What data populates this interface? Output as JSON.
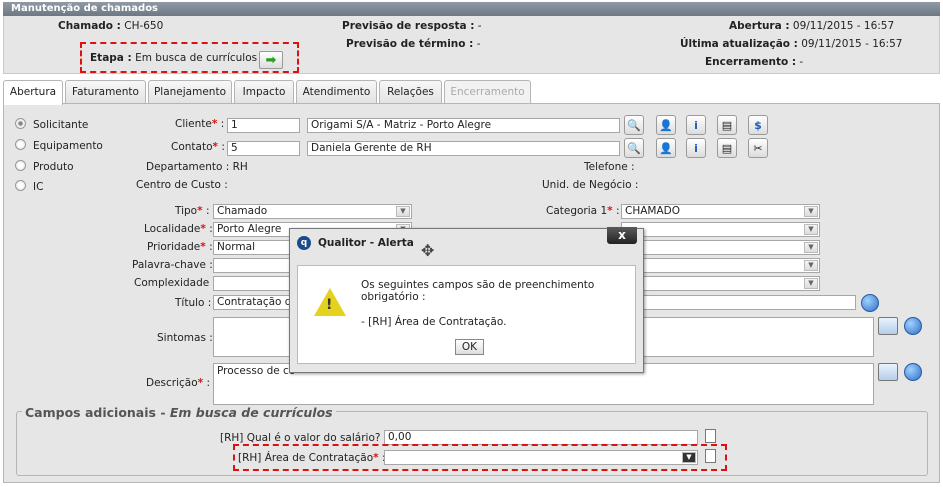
{
  "window_title": "Manutenção de chamados",
  "header": {
    "chamado_label": "Chamado :",
    "chamado_value": "CH-650",
    "previsao_resposta_label": "Previsão de resposta :",
    "previsao_resposta_value": "-",
    "previsao_termino_label": "Previsão de término :",
    "previsao_termino_value": "-",
    "abertura_label": "Abertura :",
    "abertura_value": "09/11/2015 - 16:57",
    "ultima_label": "Última atualização :",
    "ultima_value": "09/11/2015 - 16:57",
    "encerramento_label": "Encerramento :",
    "encerramento_value": "-",
    "etapa_label": "Etapa :",
    "etapa_value": "Em busca de currículos"
  },
  "tabs": [
    {
      "label": "Abertura"
    },
    {
      "label": "Faturamento"
    },
    {
      "label": "Planejamento"
    },
    {
      "label": "Impacto"
    },
    {
      "label": "Atendimento"
    },
    {
      "label": "Relações"
    },
    {
      "label": "Encerramento"
    }
  ],
  "radios": [
    {
      "label": "Solicitante",
      "selected": true
    },
    {
      "label": "Equipamento",
      "selected": false
    },
    {
      "label": "Produto",
      "selected": false
    },
    {
      "label": "IC",
      "selected": false
    }
  ],
  "form": {
    "cliente_label": "Cliente",
    "cliente_code": "1",
    "cliente_name": "Origami S/A - Matriz - Porto Alegre",
    "contato_label": "Contato",
    "contato_code": "5",
    "contato_name": "Daniela Gerente de RH",
    "departamento_label": "Departamento :",
    "departamento_value": "RH",
    "centro_label": "Centro de Custo :",
    "centro_value": "",
    "telefone_label": "Telefone :",
    "telefone_value": "",
    "unid_label": "Unid. de Negócio :",
    "unid_value": "",
    "tipo_label": "Tipo",
    "tipo_value": "Chamado",
    "localidade_label": "Localidade",
    "localidade_value": "Porto Alegre",
    "prioridade_label": "Prioridade",
    "prioridade_value": "Normal",
    "palavra_label": "Palavra-chave :",
    "complexidade_label": "Complexidade :",
    "titulo_label": "Título :",
    "titulo_value": "Contratação de",
    "sintomas_label": "Sintomas :",
    "descricao_label": "Descrição",
    "descricao_value": "Processo de co",
    "categoria_label": "Categoria 1",
    "categoria_value": "CHAMADO"
  },
  "extra": {
    "legend_prefix": "Campos adicionais - ",
    "legend_stage": "Em busca de currículos",
    "salario_label": "[RH] Qual é o valor do salário? :",
    "salario_value": "0,00",
    "area_label": "[RH] Área de Contratação",
    "area_value": ""
  },
  "modal": {
    "title": "Qualitor - Alerta",
    "close": "x",
    "line1": "Os seguintes campos são de preenchimento",
    "line2": "obrigatório :",
    "line3": "- [RH] Área de Contratação.",
    "ok": "OK"
  },
  "colors": {
    "required": "#dd1111",
    "dashed_highlight": "#dd1111"
  }
}
